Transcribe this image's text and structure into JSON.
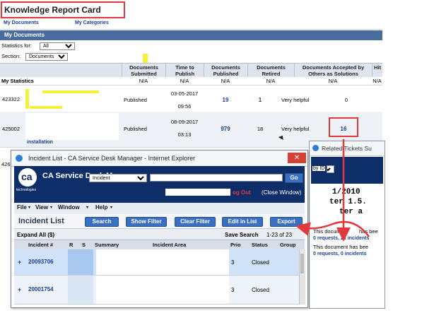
{
  "app": {
    "title": "Knowledge Report Card"
  },
  "nav": {
    "my_documents": "My Documents",
    "my_categories": "My Categories"
  },
  "section": {
    "title": "My Documents"
  },
  "filters": {
    "statistics_label": "Statistics for:",
    "statistics_value": "All",
    "section_label": "Section:",
    "section_value": "Documents"
  },
  "table": {
    "headers": {
      "submitted": "Documents Submitted",
      "time_to_publish": "Time to Publish",
      "published": "Documents Published",
      "retired": "Documents Retired",
      "accepted": "Documents Accepted by Others as Solutions",
      "hits": "Hit"
    },
    "stats_label": "My Statistics",
    "stats_values": {
      "submitted": "N/A",
      "time_to_publish": "N/A",
      "published": "N/A",
      "retired": "N/A",
      "accepted": "N/A",
      "hits": "N/A"
    },
    "rows": [
      {
        "id": "423322",
        "status": "Published",
        "date": "03-05-2017",
        "time": "09:56",
        "published": "19",
        "retired": "1",
        "rating": "Very helpful",
        "accepted": "0"
      },
      {
        "id": "425002",
        "status": "Published",
        "date": "08-09-2017",
        "time": "03:13",
        "published": "979",
        "retired": "18",
        "rating": "Very helpful",
        "accepted": "16"
      }
    ],
    "partial_id": "426",
    "partial_text": "installation"
  },
  "incident_window": {
    "title": "Incident List - CA Service Desk Manager - Internet Explorer",
    "close_label": "✕",
    "product_name": "CA Service Desk M",
    "logo_text": "ca",
    "logo_sub": "technologies",
    "search_type": "Incident",
    "go_label": "Go",
    "logout_label": "og Out",
    "close_window_label": "(Close Window)",
    "menu": [
      "File",
      "View",
      "Window",
      "Help"
    ],
    "list_title": "Incident List",
    "buttons": {
      "search": "Search",
      "show_filter": "Show Filter",
      "clear_filter": "Clear Filter",
      "edit_in_list": "Edit in List",
      "export": "Export"
    },
    "expand_all": "Expand All ($)",
    "save_search": "Save Search",
    "range": "1-23 of 23",
    "columns": {
      "incident": "Incident #",
      "r": "R",
      "s": "S",
      "summary": "Summary",
      "area": "Incident Area",
      "prio": "Prio",
      "status": "Status",
      "group": "Group"
    },
    "rows": [
      {
        "expand": "+",
        "incident": "20093706",
        "prio": "3",
        "status": "Closed"
      },
      {
        "expand": "+",
        "incident": "20001754",
        "prio": "3",
        "status": "Closed"
      }
    ]
  },
  "related_window": {
    "title": "Related Tickets Su",
    "by_label": "by ID",
    "big_text_1": "1/2010",
    "big_text_2": "ter 1.5.",
    "big_text_3": "ter a",
    "line1": "This docume",
    "line1b": "has bee",
    "req1": "0 requests, 23 incidents",
    "line2": "This document has bee",
    "req2": "0 requests, 0 incidents"
  },
  "colors": {
    "highlight_red": "#e0393e",
    "header_blue": "#4a6b9e",
    "casd_navy": "#0d2e68",
    "button_blue": "#3a6fc2",
    "link_blue": "#1a3f8f"
  }
}
